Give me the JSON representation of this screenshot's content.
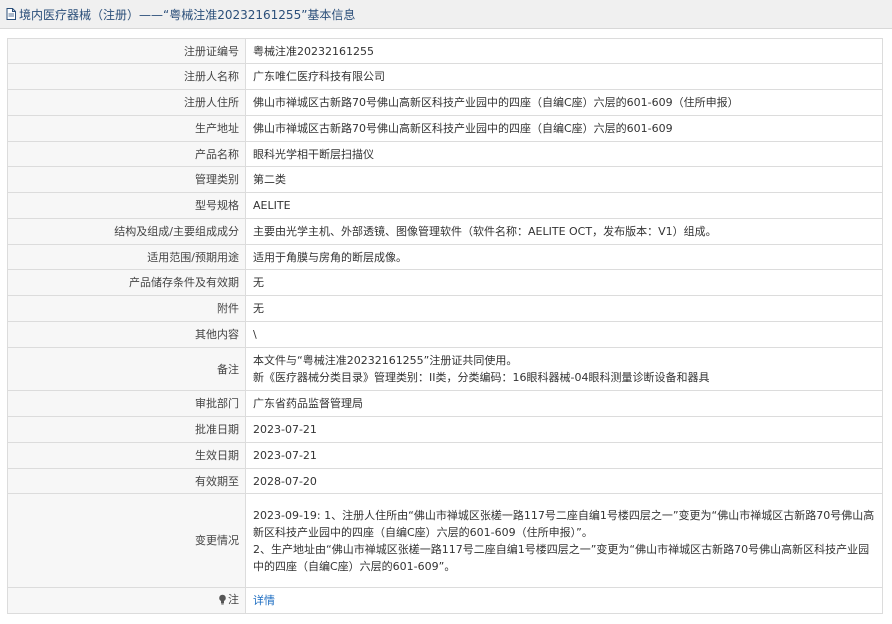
{
  "header": {
    "title": "境内医疗器械（注册）——“粤械注准20232161255”基本信息",
    "icon": "document-icon"
  },
  "rows": [
    {
      "label": "注册证编号",
      "value": "粤械注准20232161255"
    },
    {
      "label": "注册人名称",
      "value": "广东唯仁医疗科技有限公司"
    },
    {
      "label": "注册人住所",
      "value": "佛山市禅城区古新路70号佛山高新区科技产业园中的四座（自编C座）六层的601-609（住所申报）"
    },
    {
      "label": "生产地址",
      "value": "佛山市禅城区古新路70号佛山高新区科技产业园中的四座（自编C座）六层的601-609"
    },
    {
      "label": "产品名称",
      "value": "眼科光学相干断层扫描仪"
    },
    {
      "label": "管理类别",
      "value": "第二类"
    },
    {
      "label": "型号规格",
      "value": "AELITE"
    },
    {
      "label": "结构及组成/主要组成成分",
      "value": "主要由光学主机、外部透镜、图像管理软件（软件名称：AELITE OCT，发布版本：V1）组成。"
    },
    {
      "label": "适用范围/预期用途",
      "value": "适用于角膜与房角的断层成像。"
    },
    {
      "label": "产品储存条件及有效期",
      "value": "无"
    },
    {
      "label": "附件",
      "value": "无"
    },
    {
      "label": "其他内容",
      "value": "\\"
    },
    {
      "label": "备注",
      "value": "本文件与“粤械注准20232161255”注册证共同使用。\n新《医疗器械分类目录》管理类别：II类，分类编码：16眼科器械-04眼科测量诊断设备和器具"
    },
    {
      "label": "审批部门",
      "value": "广东省药品监督管理局"
    },
    {
      "label": "批准日期",
      "value": "2023-07-21"
    },
    {
      "label": "生效日期",
      "value": "2023-07-21"
    },
    {
      "label": "有效期至",
      "value": "2028-07-20"
    },
    {
      "label": "变更情况",
      "value": "2023-09-19: 1、注册人住所由“佛山市禅城区张槎一路117号二座自编1号楼四层之一”变更为“佛山市禅城区古新路70号佛山高新区科技产业园中的四座（自编C座）六层的601-609（住所申报）”。\n2、生产地址由“佛山市禅城区张槎一路117号二座自编1号楼四层之一”变更为“佛山市禅城区古新路70号佛山高新区科技产业园中的四座（自编C座）六层的601-609”。"
    }
  ],
  "note": {
    "label": "注",
    "icon": "lightbulb-icon",
    "link_text": "详情"
  }
}
